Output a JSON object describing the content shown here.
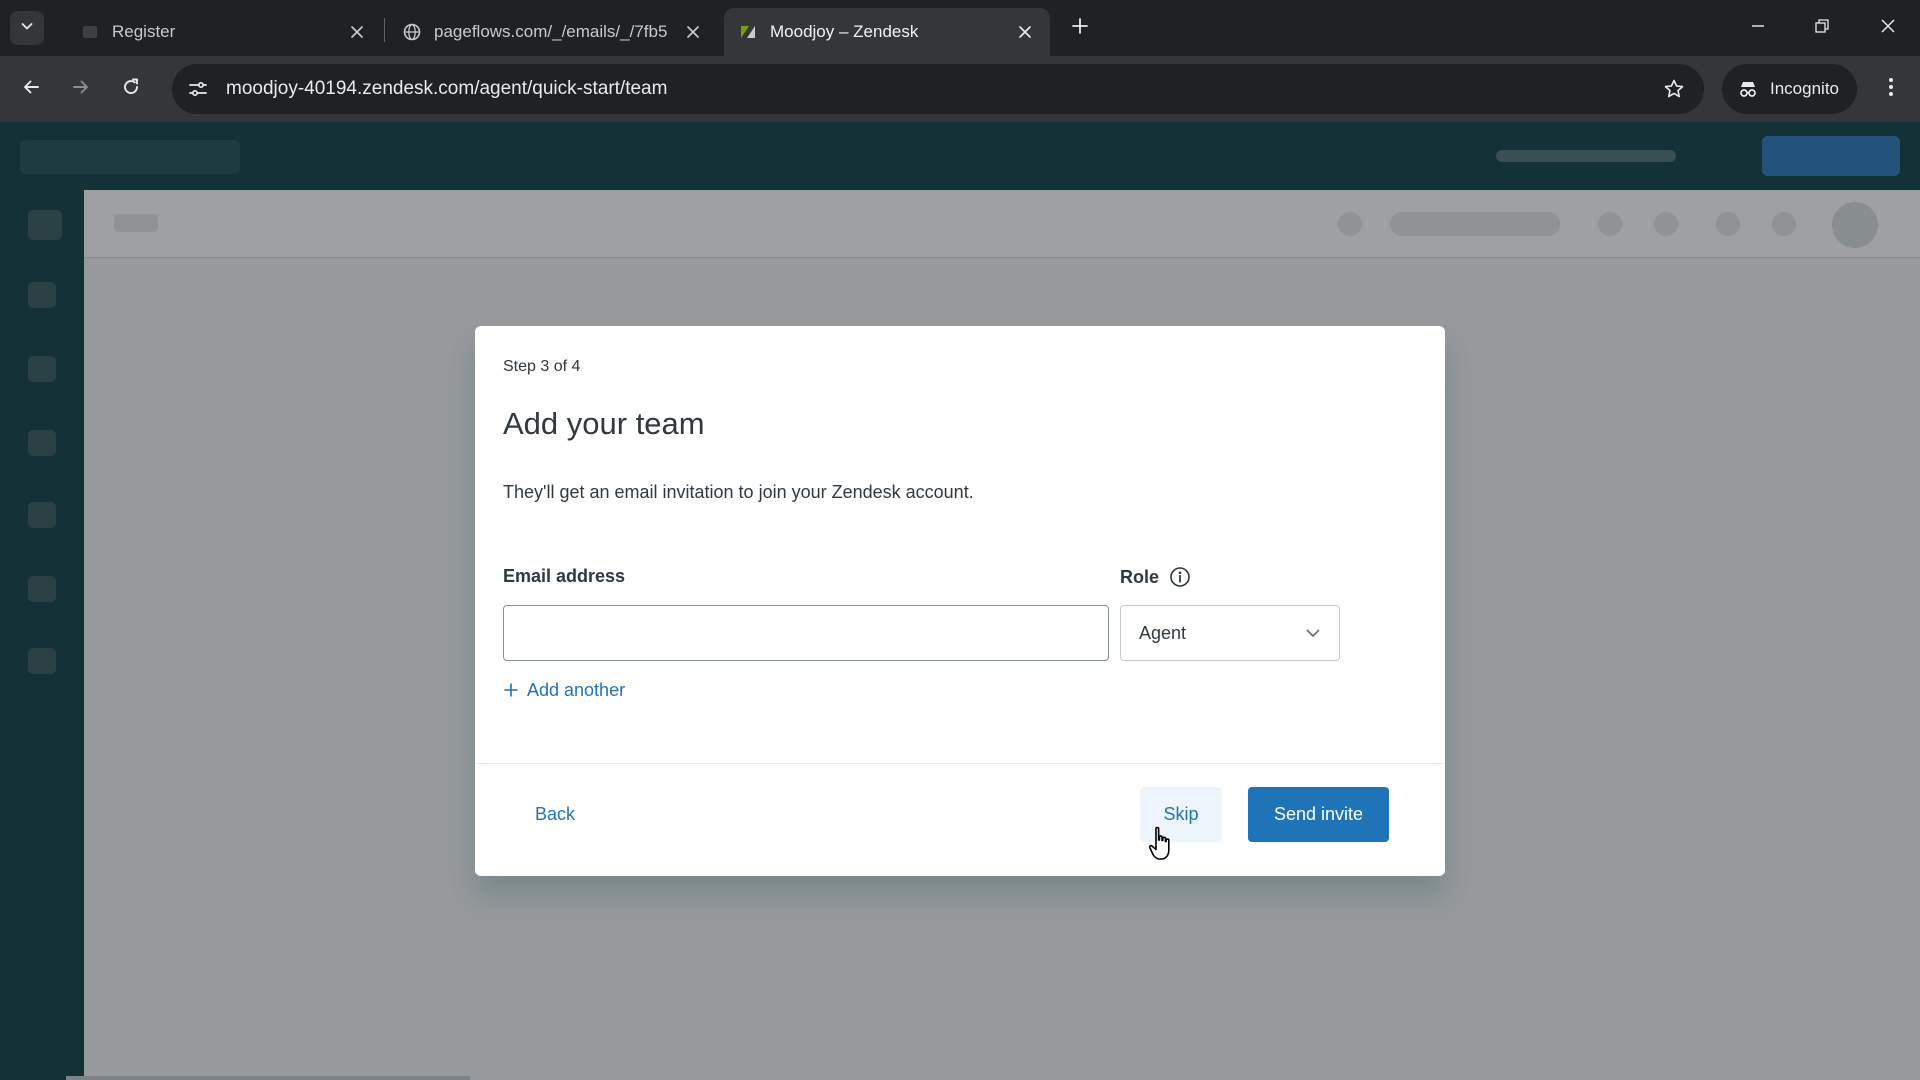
{
  "browser": {
    "tabs": [
      {
        "title": "Register",
        "active": false
      },
      {
        "title": "pageflows.com/_/emails/_/7fb5",
        "active": false
      },
      {
        "title": "Moodjoy – Zendesk",
        "active": true
      }
    ],
    "url": "moodjoy-40194.zendesk.com/agent/quick-start/team",
    "profile_label": "Incognito"
  },
  "modal": {
    "step": "Step 3 of 4",
    "title": "Add your team",
    "subtitle": "They'll get an email invitation to join your Zendesk account.",
    "email_label": "Email address",
    "email_value": "",
    "email_placeholder": "",
    "role_label": "Role",
    "role_value": "Agent",
    "add_another": "Add another",
    "back": "Back",
    "skip": "Skip",
    "send": "Send invite"
  },
  "colors": {
    "brand_dark": "#03363d",
    "primary_blue": "#1f73b7"
  }
}
